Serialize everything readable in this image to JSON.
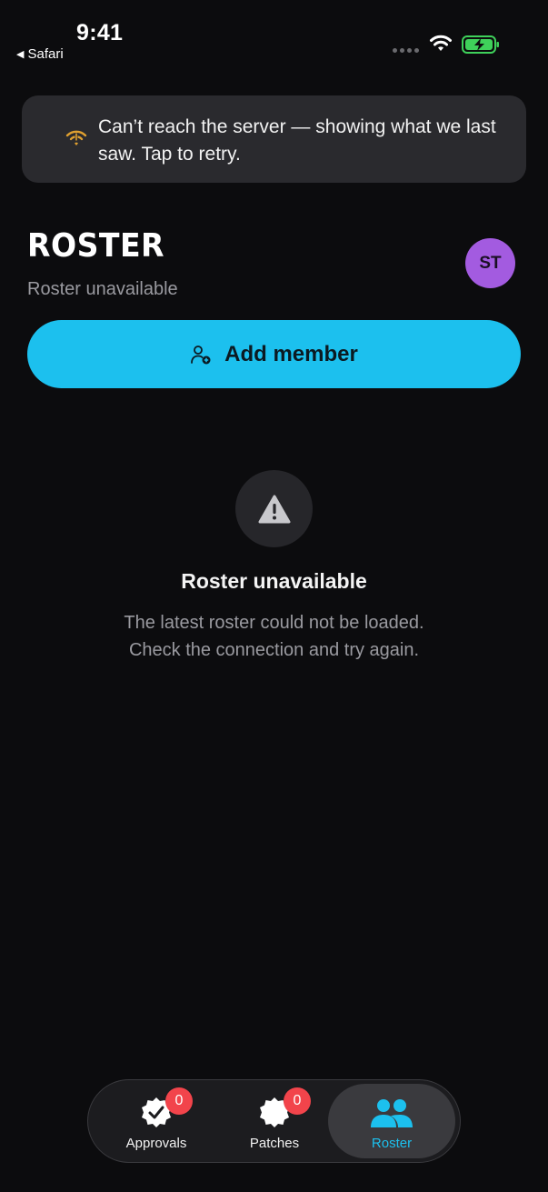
{
  "status_bar": {
    "time": "9:41",
    "back_app": "Safari"
  },
  "banner": {
    "message": "Can’t reach the server — showing what we last saw. Tap to retry.",
    "icon": "wifi-off-icon",
    "icon_color": "#e0a030"
  },
  "header": {
    "title": "ROSTER",
    "subtitle": "Roster unavailable",
    "avatar_initials": "ST",
    "avatar_color": "#a35be0"
  },
  "add_member": {
    "label": "Add member",
    "icon": "add-user-icon",
    "color": "#1cc0ee"
  },
  "empty_state": {
    "icon": "warning-icon",
    "title": "Roster unavailable",
    "line1": "The latest roster could not be loaded.",
    "line2": "Check the connection and try again."
  },
  "tabs": [
    {
      "label": "Approvals",
      "icon": "approval-badge-icon",
      "badge": "0",
      "active": false
    },
    {
      "label": "Patches",
      "icon": "patch-badge-icon",
      "badge": "0",
      "active": false
    },
    {
      "label": "Roster",
      "icon": "people-icon",
      "active": true
    }
  ],
  "colors": {
    "background": "#0c0c0e",
    "accent": "#1cc0ee",
    "badge": "#f2444b"
  }
}
